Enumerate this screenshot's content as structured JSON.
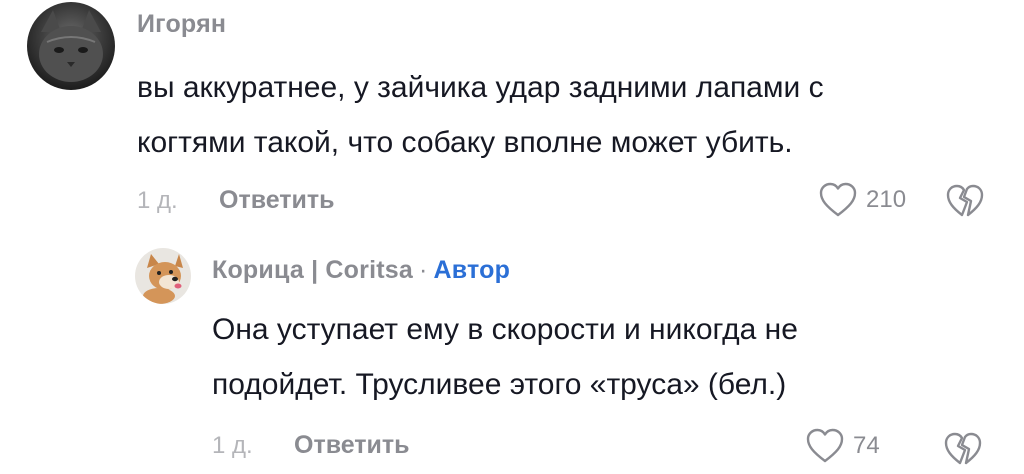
{
  "comments": [
    {
      "username": "Игорян",
      "text_lines": [
        "вы аккуратнее, у зайчика удар задними лапами с",
        "когтями такой, что собаку вполне может убить."
      ],
      "time": "1 д.",
      "reply_label": "Ответить",
      "likes": "210",
      "avatar_icon": "cat-avatar"
    },
    {
      "username": "Корица | Coritsa",
      "separator": "·",
      "author_badge": "Автор",
      "text_lines": [
        "Она уступает ему в скорости и никогда не",
        "подойдет. Трусливее этого «труса» (бел.)"
      ],
      "time": "1 д.",
      "reply_label": "Ответить",
      "likes": "74",
      "avatar_icon": "dog-avatar"
    }
  ],
  "colors": {
    "text": "#161823",
    "muted": "#8a8b91",
    "time": "#b4b5b9",
    "author_badge": "#2b6fd6"
  }
}
